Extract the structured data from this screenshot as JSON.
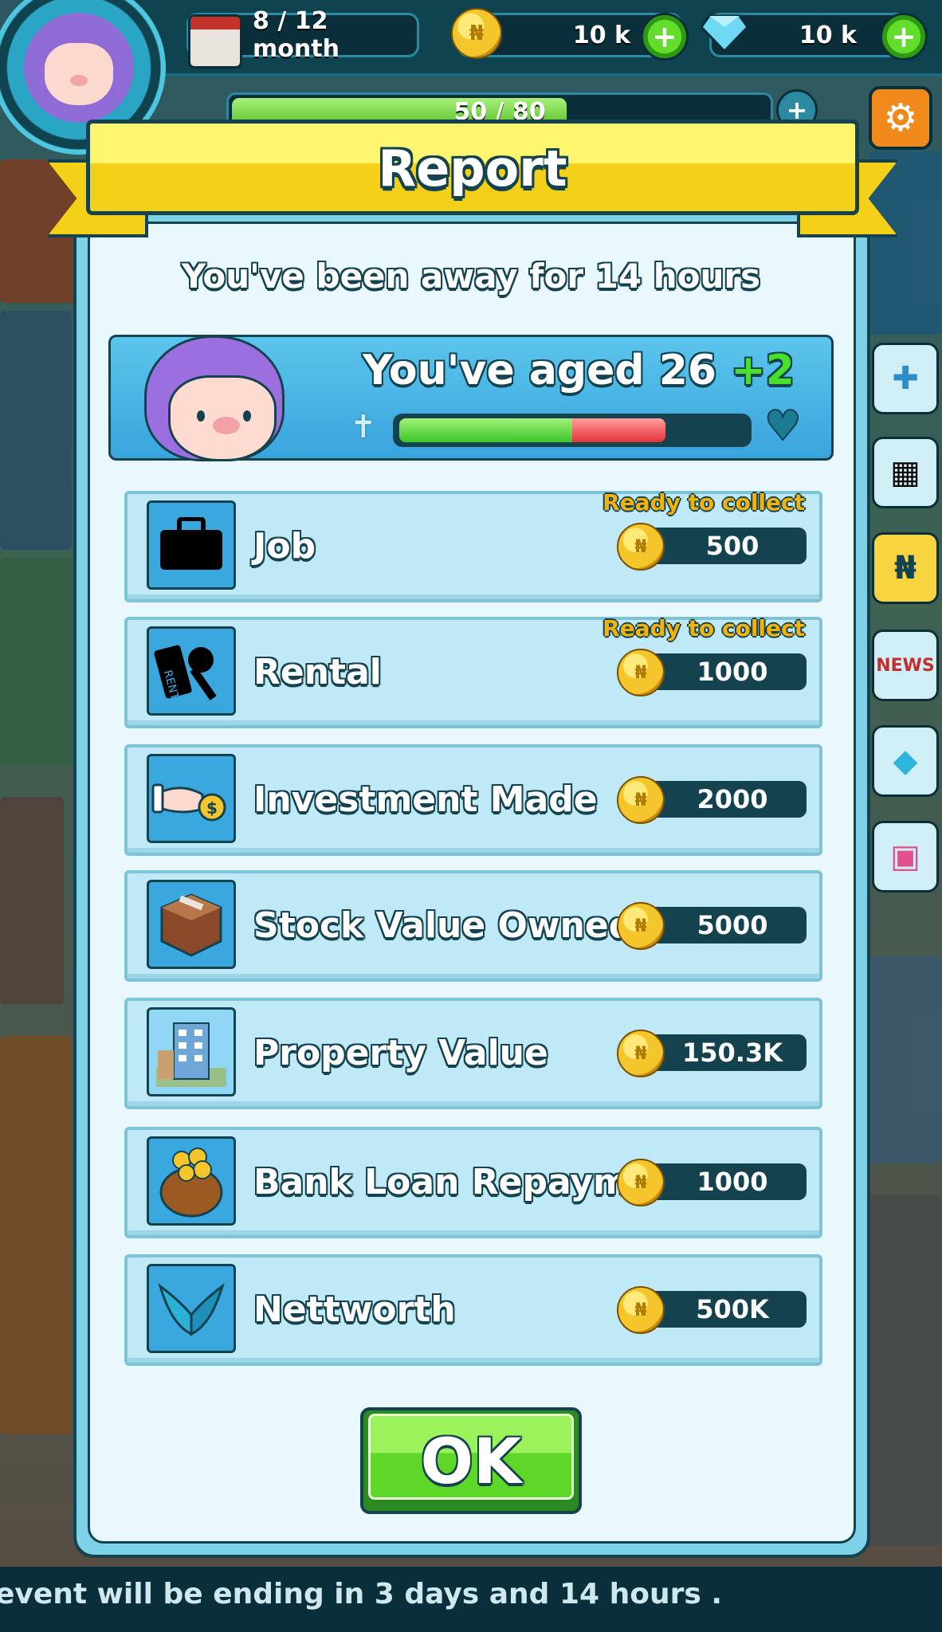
{
  "hud": {
    "month": "8 / 12 month",
    "coins": "10 k",
    "gems": "10 k",
    "coin_symbol": "₦",
    "xp": "50 / 80",
    "xp_progress": 0.625
  },
  "dialog": {
    "title": "Report",
    "away_text": "You've been away for 14 hours",
    "age_label": "You've aged 26",
    "age_bonus": "+2",
    "life_bar": {
      "green": 0.5,
      "red": 0.27
    },
    "rows": [
      {
        "label": "Job",
        "value": "500",
        "ready": "Ready to collect",
        "icon": "briefcase-icon"
      },
      {
        "label": "Rental",
        "value": "1000",
        "ready": "Ready to collect",
        "icon": "rent-key-icon"
      },
      {
        "label": "Investment Made",
        "value": "2000",
        "ready": "",
        "icon": "hand-coin-icon"
      },
      {
        "label": "Stock Value Owned",
        "value": "5000",
        "ready": "",
        "icon": "box-icon"
      },
      {
        "label": "Property Value",
        "value": "150.3K",
        "ready": "",
        "icon": "building-icon"
      },
      {
        "label": "Bank Loan Repayment",
        "value": "1000",
        "ready": "",
        "icon": "money-bag-icon"
      },
      {
        "label": "Nettworth",
        "value": "500K",
        "ready": "",
        "icon": "wings-icon"
      }
    ],
    "ok_label": "OK"
  },
  "ticker": "event will be ending in 3 days and 14 hours ."
}
